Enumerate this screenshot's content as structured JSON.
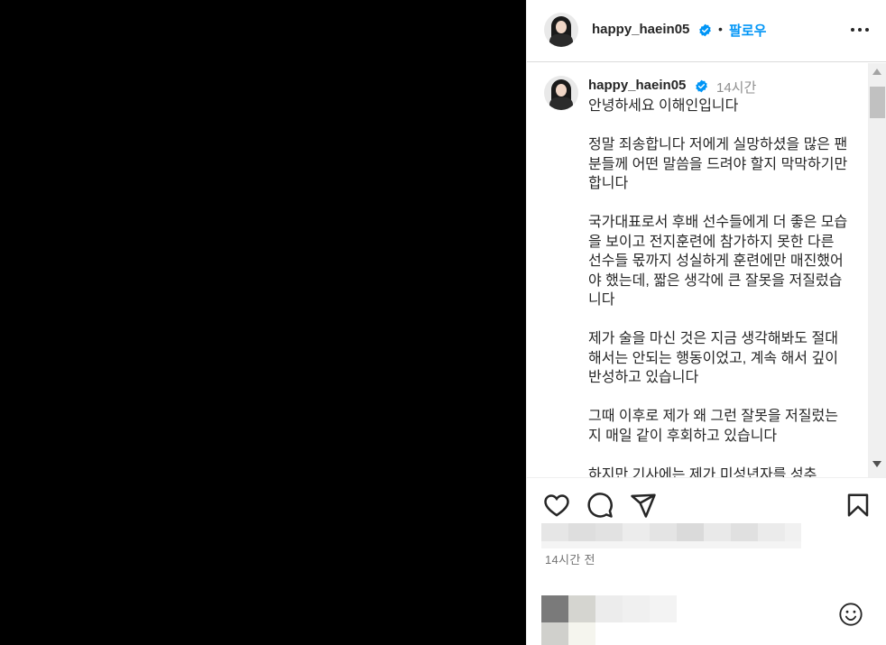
{
  "post": {
    "username": "happy_haein05",
    "follow_label": "팔로우",
    "dot": "•",
    "time_short": "14시간",
    "time_full": "14시간 전",
    "caption": "안녕하세요 이해인입니다\n\n정말 죄송합니다 저에게 실망하셨을 많은 팬분들께 어떤 말씀을 드려야 할지 막막하기만 합니다\n\n국가대표로서 후배 선수들에게 더 좋은 모습을 보이고 전지훈련에 참가하지 못한 다른 선수들 몫까지 성실하게 훈련에만 매진했어야 했는데, 짧은 생각에 큰 잘못을 저질렀습니다\n\n제가 술을 마신 것은 지금 생각해봐도 절대 해서는 안되는 행동이었고, 계속 해서 깊이 반성하고 있습니다\n\n그때 이후로 제가 왜 그런 잘못을 저질렀는지 매일 같이 후회하고 있습니다\n\n하지만 기사에는 제가 미성년자를 성추"
  },
  "colors": {
    "accent": "#0095f6",
    "verified": "#0095f6",
    "media_bg": "#000000"
  },
  "icons": {
    "like": "heart-icon",
    "comment": "comment-icon",
    "share": "paper-plane-icon",
    "save": "bookmark-icon",
    "more": "more-horizontal-icon",
    "emoji": "emoji-icon"
  }
}
